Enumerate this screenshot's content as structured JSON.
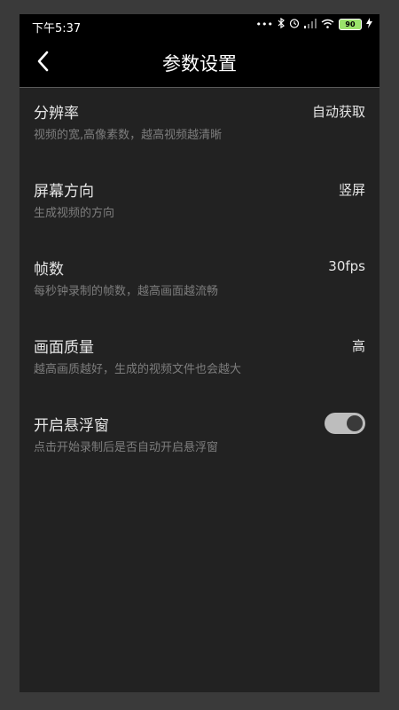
{
  "status_bar": {
    "time": "下午5:37",
    "battery": "90",
    "icons": [
      "dots-icon",
      "bluetooth-icon",
      "alarm-icon",
      "signal-icon",
      "wifi-icon",
      "battery-icon",
      "charging-icon"
    ]
  },
  "header": {
    "title": "参数设置",
    "back_icon": "back-arrow-icon"
  },
  "settings": [
    {
      "label": "分辨率",
      "description": "视频的宽,高像素数，越高视频越清晰",
      "value": "自动获取"
    },
    {
      "label": "屏幕方向",
      "description": "生成视频的方向",
      "value": "竖屏"
    },
    {
      "label": "帧数",
      "description": "每秒钟录制的帧数，越高画面越流畅",
      "value": "30fps"
    },
    {
      "label": "画面质量",
      "description": "越高画质越好，生成的视频文件也会越大",
      "value": "高"
    },
    {
      "label": "开启悬浮窗",
      "description": "点击开始录制后是否自动开启悬浮窗",
      "toggle_on": true
    }
  ],
  "colors": {
    "background": "#222222",
    "header": "#000000",
    "text_primary": "#e6e6e6",
    "text_secondary": "#7d7d7d",
    "toggle_track": "#bdbdbd",
    "battery_fill": "#9be36b"
  }
}
